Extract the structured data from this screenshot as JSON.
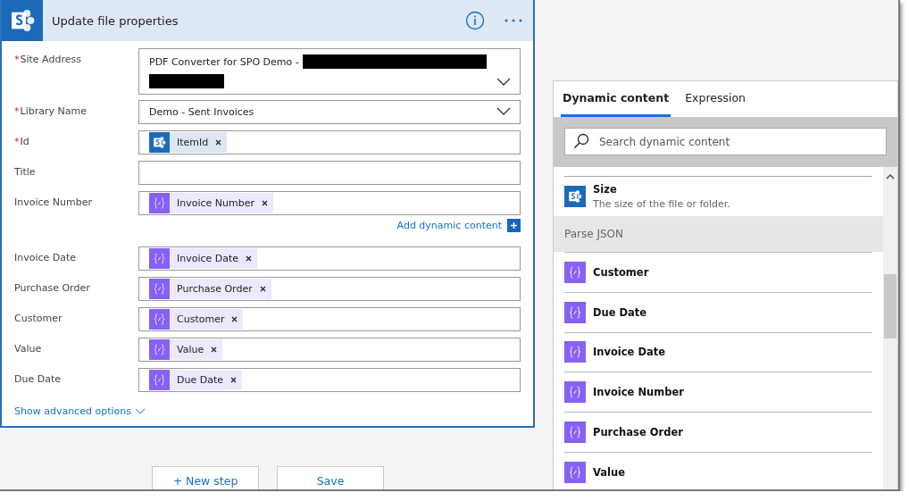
{
  "action": {
    "title": "Update file properties"
  },
  "fields": [
    {
      "label": "Site Address",
      "required_mark": "*",
      "kind": "dropdown",
      "value": "PDF Converter for SPO Demo -",
      "redacted": true
    },
    {
      "label": "Library Name",
      "required_mark": "*",
      "kind": "dropdown",
      "value": "Demo - Sent Invoices",
      "redacted": false
    },
    {
      "label": "Id",
      "required_mark": "*",
      "kind": "tokens",
      "tokens": [
        {
          "text": "ItemId",
          "kind": "sharepoint"
        }
      ]
    },
    {
      "label": "Title",
      "kind": "text"
    },
    {
      "label": "Invoice Number",
      "kind": "tokens",
      "tokens": [
        {
          "text": "Invoice Number",
          "kind": "json"
        }
      ],
      "add_link": "Add dynamic content"
    },
    {
      "label": "Invoice Date",
      "kind": "tokens",
      "tokens": [
        {
          "text": "Invoice Date",
          "kind": "json"
        }
      ]
    },
    {
      "label": "Purchase Order",
      "kind": "tokens",
      "tokens": [
        {
          "text": "Purchase Order",
          "kind": "json"
        }
      ]
    },
    {
      "label": "Customer",
      "kind": "tokens",
      "tokens": [
        {
          "text": "Customer",
          "kind": "json"
        }
      ]
    },
    {
      "label": "Value",
      "kind": "tokens",
      "tokens": [
        {
          "text": "Value",
          "kind": "json"
        }
      ]
    },
    {
      "label": "Due Date",
      "kind": "tokens",
      "tokens": [
        {
          "text": "Due Date",
          "kind": "json"
        }
      ]
    }
  ],
  "advanced_link": "Show advanced options",
  "buttons": [
    "+ New step",
    "Save"
  ],
  "panel": {
    "tabs": [
      {
        "label": "Dynamic content",
        "selected": true
      },
      {
        "label": "Expression",
        "selected": false
      }
    ],
    "search": {
      "placeholder": "Search dynamic content"
    },
    "items": [
      {
        "kind": "sharepoint",
        "title": "Size",
        "description": "The size of the file or folder."
      },
      {
        "kind": "group",
        "title": "Parse JSON"
      },
      {
        "kind": "json",
        "title": "Customer"
      },
      {
        "kind": "json",
        "title": "Due Date"
      },
      {
        "kind": "json",
        "title": "Invoice Date"
      },
      {
        "kind": "json",
        "title": "Invoice Number"
      },
      {
        "kind": "json",
        "title": "Purchase Order"
      },
      {
        "kind": "json",
        "title": "Value"
      }
    ]
  }
}
